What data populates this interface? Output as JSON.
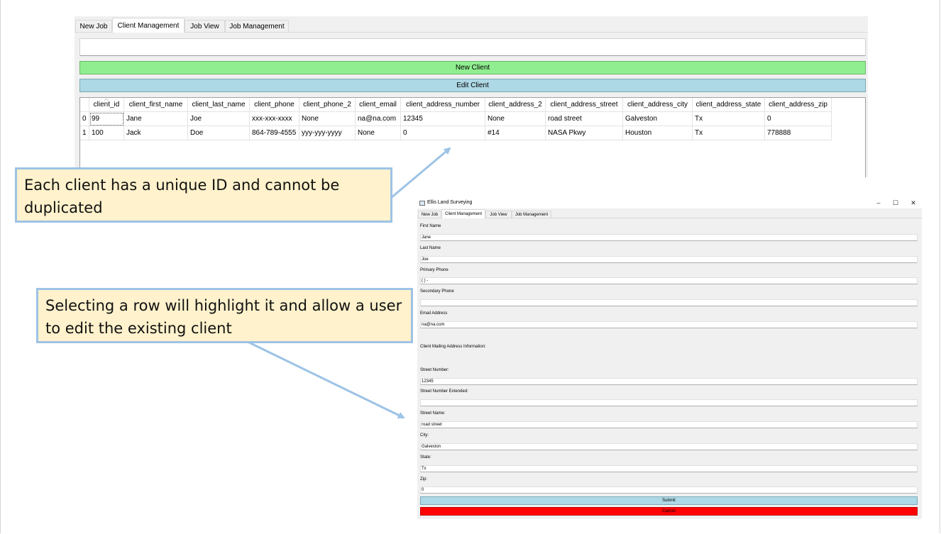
{
  "main_window": {
    "tabs": [
      {
        "label": "New Job"
      },
      {
        "label": "Client Management"
      },
      {
        "label": "Job View"
      },
      {
        "label": "Job Management"
      }
    ],
    "active_tab": "Client Management",
    "search_value": "",
    "new_client_label": "New Client",
    "edit_client_label": "Edit Client",
    "table": {
      "columns": [
        "client_id",
        "client_first_name",
        "client_last_name",
        "client_phone",
        "client_phone_2",
        "client_email",
        "client_address_number",
        "client_address_2",
        "client_address_street",
        "client_address_city",
        "client_address_state",
        "client_address_zip"
      ],
      "rows": [
        {
          "index": "0",
          "cells": [
            "99",
            "Jane",
            "Joe",
            "xxx-xxx-xxxx",
            "None",
            "na@na.com",
            "12345",
            "None",
            "road street",
            "Galveston",
            "Tx",
            "0"
          ]
        },
        {
          "index": "1",
          "cells": [
            "100",
            "Jack",
            "Doe",
            "864-789-4555",
            "yyy-yyy-yyyy",
            "None",
            "0",
            "#14",
            "NASA Pkwy",
            "Houston",
            "Tx",
            "778888"
          ]
        }
      ]
    },
    "colors": {
      "new_client": "#90ee90",
      "edit_client": "#add8e6"
    }
  },
  "callouts": {
    "unique_id": "Each client has a unique ID and cannot be duplicated",
    "select_row": "Selecting a row will highlight it and allow a user to edit the existing client"
  },
  "dialog": {
    "title": "Ellis Land Surveying",
    "controls": {
      "minimize": "–",
      "maximize": "☐",
      "close": "✕"
    },
    "tabs": [
      {
        "label": "New Job"
      },
      {
        "label": "Client Management"
      },
      {
        "label": "Job View"
      },
      {
        "label": "Job Management"
      }
    ],
    "fields": {
      "first_name": {
        "label": "First Name",
        "value": "Jane"
      },
      "last_name": {
        "label": "Last Name",
        "value": "Joe"
      },
      "primary_phone": {
        "label": "Primary Phone",
        "value": "(  )  -"
      },
      "secondary_phone": {
        "label": "Secondary Phone",
        "value": ""
      },
      "email": {
        "label": "Email Address",
        "value": "na@na.com"
      },
      "mailing_header": "Client Mailing Address Information:",
      "street_number": {
        "label": "Street Number:",
        "value": "12345"
      },
      "street_number_ext": {
        "label": "Street Number Extended:",
        "value": ""
      },
      "street_name": {
        "label": "Street Name:",
        "value": "road street"
      },
      "city": {
        "label": "City:",
        "value": "Galveston"
      },
      "state": {
        "label": "State:",
        "value": "Tx"
      },
      "zip": {
        "label": "Zip:",
        "value": "0"
      }
    },
    "submit_label": "Submit",
    "cancel_label": "Cancel",
    "colors": {
      "submit": "#add8e6",
      "cancel": "#ff0000"
    }
  }
}
